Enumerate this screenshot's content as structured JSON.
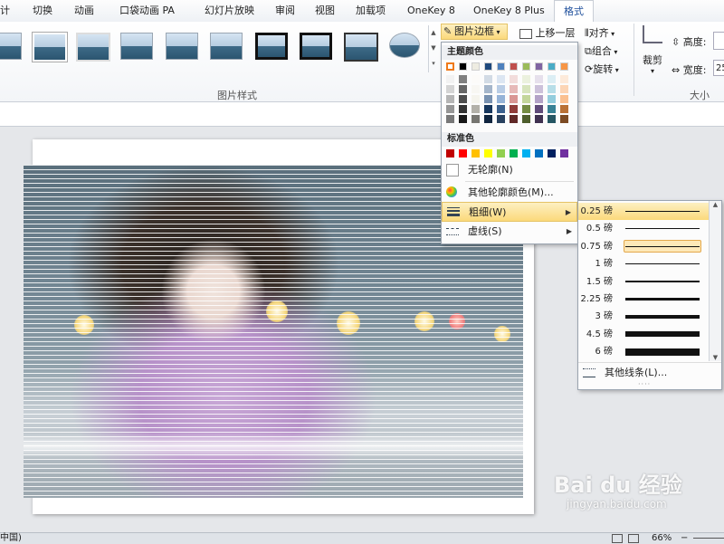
{
  "tabs": [
    "计",
    "切换",
    "动画",
    "口袋动画 PA",
    "幻灯片放映",
    "审阅",
    "视图",
    "加载项",
    "OneKey 8",
    "OneKey 8 Plus",
    "格式"
  ],
  "ribbon": {
    "picture_border_label": "图片边框",
    "move_forward_label": "上移一层",
    "align_label": "对齐",
    "group_label": "组合",
    "rotate_label": "旋转",
    "crop_label": "裁剪",
    "height_label": "高度:",
    "width_label": "宽度:",
    "width_value": "25",
    "picture_styles_group": "图片样式",
    "size_group": "大小"
  },
  "menu": {
    "theme_colors_label": "主题颜色",
    "standard_colors_label": "标准色",
    "no_outline_label": "无轮廓(N)",
    "more_colors_label": "其他轮廓颜色(M)...",
    "weight_label": "粗细(W)",
    "dashes_label": "虚线(S)",
    "theme_top_row": [
      "#ffffff",
      "#000000",
      "#eeece1",
      "#1f497d",
      "#4f81bd",
      "#c0504d",
      "#9bbb59",
      "#8064a2",
      "#4bacc6",
      "#f79646"
    ],
    "standard_colors": [
      "#c00000",
      "#ff0000",
      "#ffc000",
      "#ffff00",
      "#92d050",
      "#00b050",
      "#00b0f0",
      "#0070c0",
      "#002060",
      "#7030a0"
    ]
  },
  "weight_submenu": {
    "items": [
      {
        "label": "0.25 磅",
        "weight": 0.25
      },
      {
        "label": "0.5 磅",
        "weight": 0.5
      },
      {
        "label": "0.75 磅",
        "weight": 0.75
      },
      {
        "label": "1 磅",
        "weight": 1
      },
      {
        "label": "1.5 磅",
        "weight": 1.5
      },
      {
        "label": "2.25 磅",
        "weight": 2.25
      },
      {
        "label": "3 磅",
        "weight": 3
      },
      {
        "label": "4.5 磅",
        "weight": 4.5
      },
      {
        "label": "6 磅",
        "weight": 6
      }
    ],
    "more_lines_label": "其他线条(L)..."
  },
  "status": {
    "language": "中国)",
    "zoom": "66%"
  },
  "watermark": {
    "brand": "Bai du 经验",
    "url": "jingyan.baidu.com"
  }
}
